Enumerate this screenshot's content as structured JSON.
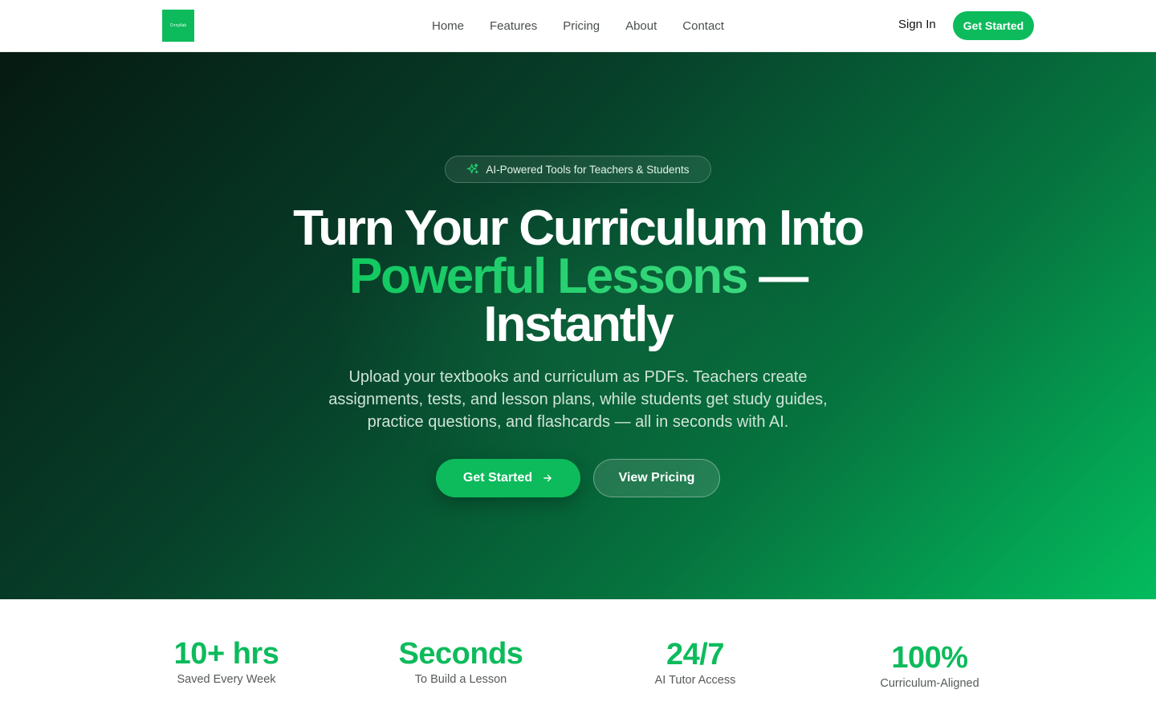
{
  "nav": {
    "logo_text": "Crrsyllab",
    "links": [
      "Home",
      "Features",
      "Pricing",
      "About",
      "Contact"
    ],
    "sign_in": "Sign In",
    "cta": "Get Started"
  },
  "hero": {
    "badge": "AI-Powered Tools for Teachers & Students",
    "headline_line1": "Turn Your Curriculum Into",
    "headline_accent": "Powerful Lessons",
    "headline_dash": " —",
    "headline_line3": "Instantly",
    "subtext": "Upload your textbooks and curriculum as PDFs. Teachers create assignments, tests, and lesson plans, while students get study guides, practice questions, and flashcards — all in seconds with AI.",
    "primary_button": "Get Started",
    "secondary_button": "View Pricing"
  },
  "stats": [
    {
      "value": "10+ hrs",
      "label": "Saved Every Week"
    },
    {
      "value": "Seconds",
      "label": "To Build a Lesson"
    },
    {
      "value": "24/7",
      "label": "AI Tutor Access"
    },
    {
      "value": "100%",
      "label": "Curriculum-Aligned"
    }
  ],
  "colors": {
    "brand": "#0dbb5c",
    "hero_dark": "#061a11"
  }
}
